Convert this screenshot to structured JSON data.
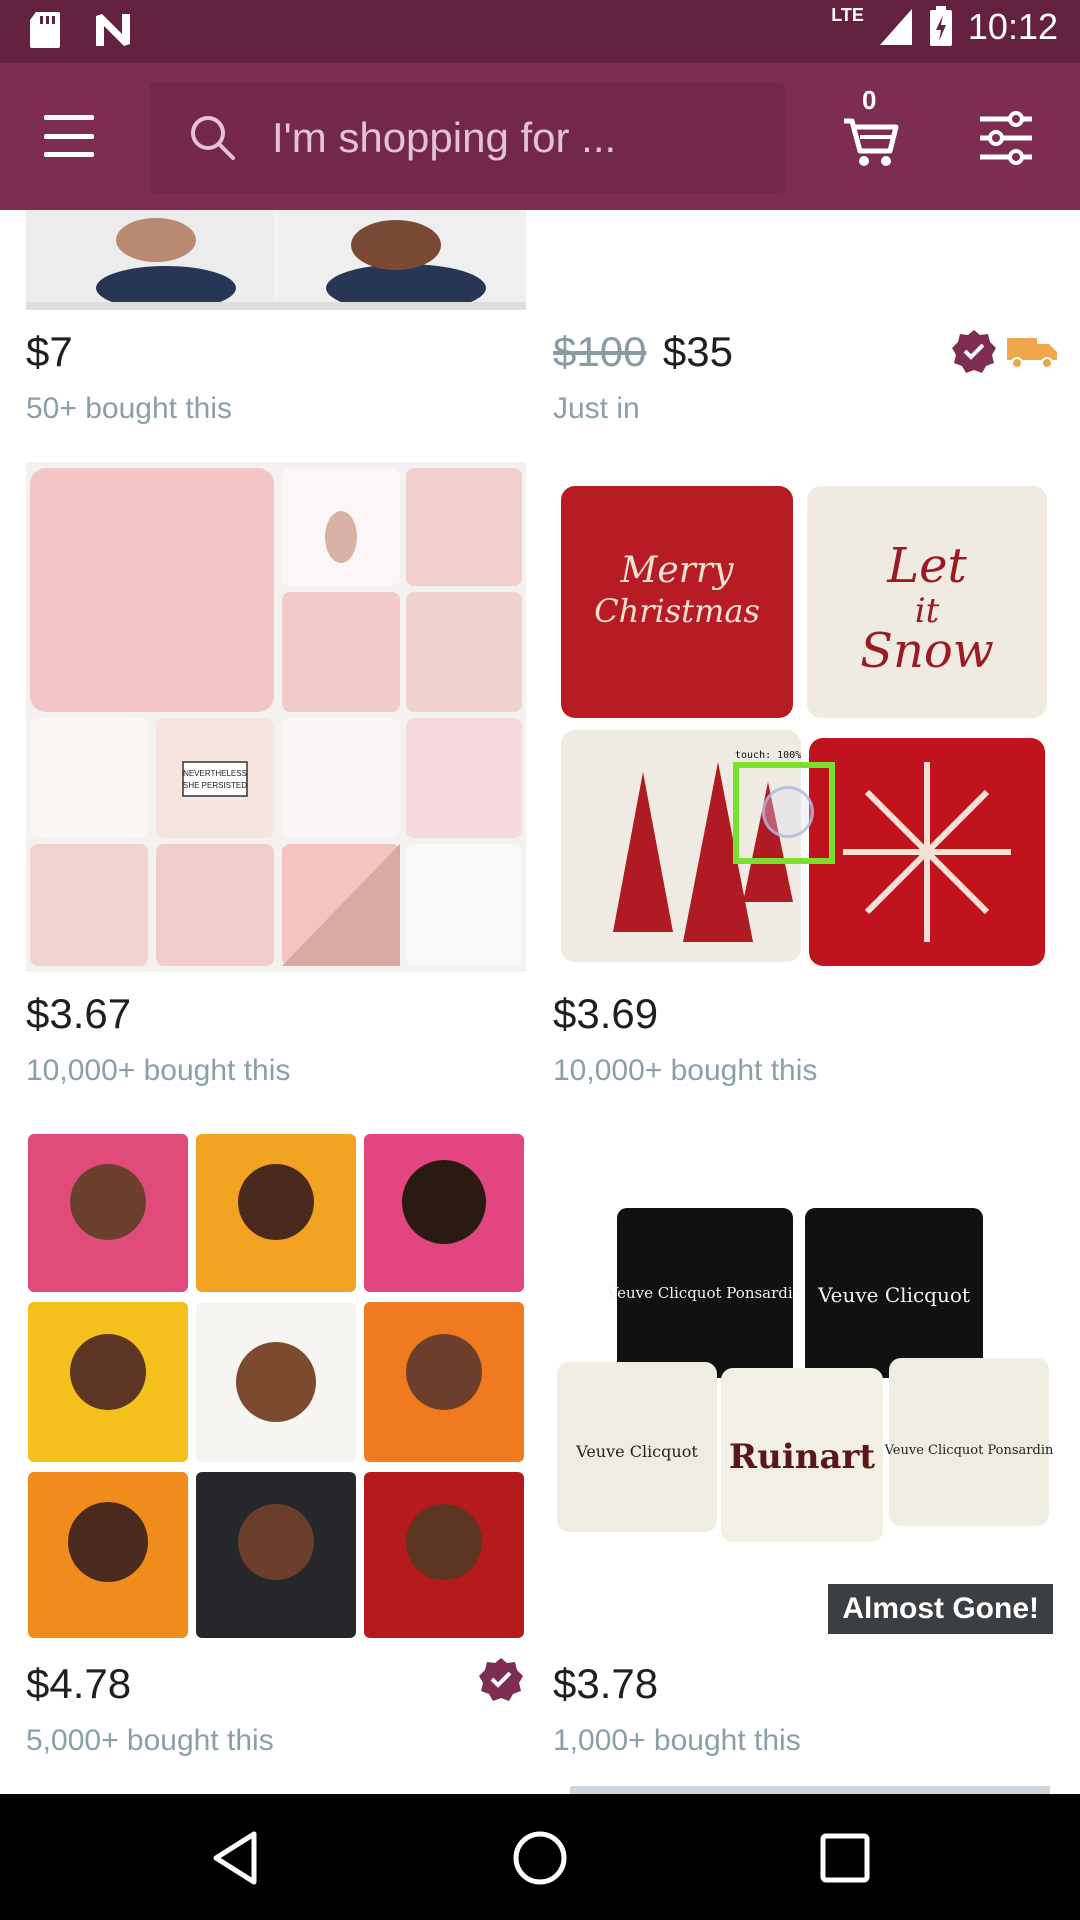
{
  "status_bar": {
    "network": "LTE",
    "time": "10:12"
  },
  "header": {
    "search_placeholder": "I'm shopping for ...",
    "cart_count": "0"
  },
  "feed": {
    "items": [
      {
        "price": "$7",
        "original_price": "",
        "subtext": "50+ bought this",
        "verified": false,
        "shipping": false,
        "badge": ""
      },
      {
        "price": "$35",
        "original_price": "$100",
        "subtext": "Just in",
        "verified": true,
        "shipping": true,
        "badge": ""
      },
      {
        "price": "$3.67",
        "original_price": "",
        "subtext": "10,000+ bought this",
        "verified": false,
        "shipping": false,
        "badge": "",
        "image_text": "NEVERTHELESS SHE PERSISTED"
      },
      {
        "price": "$3.69",
        "original_price": "",
        "subtext": "10,000+ bought this",
        "verified": false,
        "shipping": false,
        "badge": "",
        "image_text": [
          "Merry Christmas",
          "Let it Snow"
        ]
      },
      {
        "price": "$4.78",
        "original_price": "",
        "subtext": "5,000+ bought this",
        "verified": true,
        "shipping": false,
        "badge": ""
      },
      {
        "price": "$3.78",
        "original_price": "",
        "subtext": "1,000+ bought this",
        "verified": false,
        "shipping": false,
        "badge": "Almost Gone!",
        "image_text": [
          "Veuve Clicquot Ponsardin",
          "Veuve Clicquot",
          "Veuve Clicquot",
          "Ruinart",
          "Veuve Clicquot Ponsardin"
        ]
      }
    ]
  },
  "overlay": {
    "touch_label": "touch: 100%"
  },
  "colors": {
    "status_bar": "#64213f",
    "header": "#7c2d51",
    "verified": "#7c2d51",
    "shipping": "#f0a64a",
    "price": "#1f1f1f",
    "subtext": "#8aa0a8"
  }
}
